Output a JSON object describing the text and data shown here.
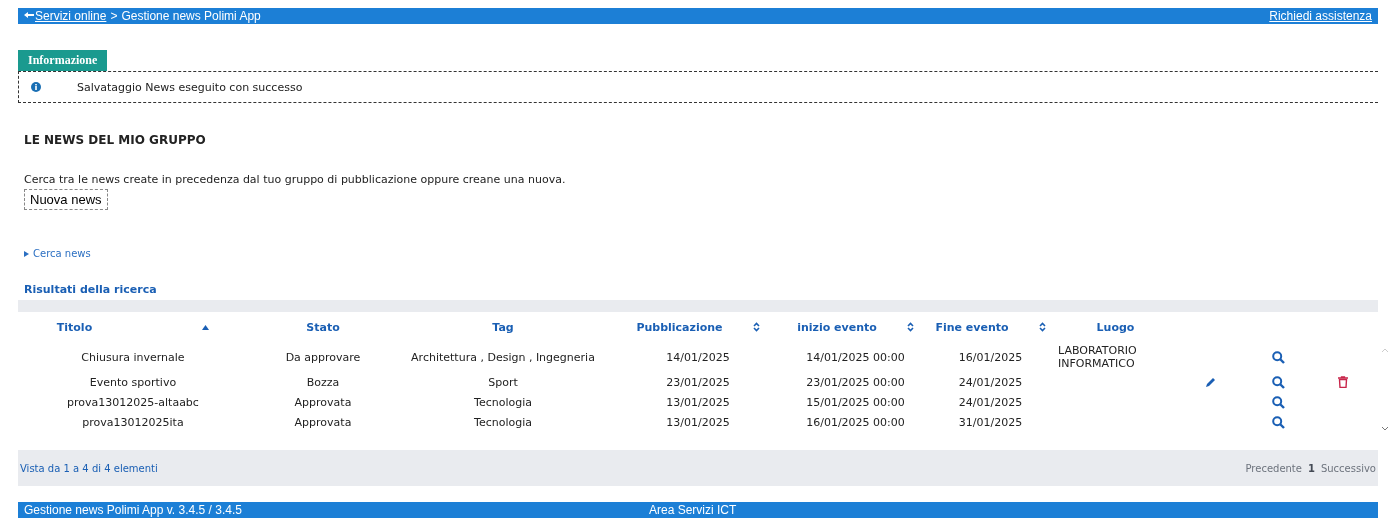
{
  "top_bar": {
    "back_link": "Servizi online",
    "separator": ">",
    "current": "Gestione news Polimi App",
    "help_link": "Richiedi assistenza"
  },
  "message": {
    "tab": "Informazione",
    "kind": "info",
    "text": "Salvataggio News eseguito con successo"
  },
  "section": {
    "title": "LE NEWS DEL MIO GRUPPO",
    "description": "Cerca tra le news create in precedenza dal tuo gruppo di pubblicazione oppure creane una nuova.",
    "new_button": "Nuova news"
  },
  "search_toggle": {
    "label": "Cerca news",
    "expanded": false
  },
  "results": {
    "title": "Risultati della ricerca",
    "columns": [
      {
        "label": "Titolo",
        "kind": "ascending"
      },
      {
        "label": "Stato",
        "kind": "plain"
      },
      {
        "label": "Tag",
        "kind": "plain"
      },
      {
        "label": "Pubblicazione",
        "kind": "sortable"
      },
      {
        "label": "inizio evento",
        "kind": "sortable"
      },
      {
        "label": "Fine evento",
        "kind": "sortable"
      },
      {
        "label": "Luogo",
        "kind": "plain"
      }
    ],
    "rows": [
      {
        "cells": [
          "Chiusura invernale",
          "Da approvare",
          "Architettura , Design , Ingegneria",
          "14/01/2025",
          "14/01/2025 00:00",
          "16/01/2025",
          "LABORATORIO INFORMATICO"
        ],
        "edit": false,
        "view": true,
        "delete": false
      },
      {
        "cells": [
          "Evento sportivo",
          "Bozza",
          "Sport",
          "23/01/2025",
          "23/01/2025 00:00",
          "24/01/2025"
        ],
        "edit": true,
        "view": true,
        "delete": true
      },
      {
        "cells": [
          "prova13012025-altaabc",
          "Approvata",
          "Tecnologia",
          "13/01/2025",
          "15/01/2025 00:00",
          "24/01/2025"
        ],
        "edit": false,
        "view": true,
        "delete": false
      },
      {
        "cells": [
          "prova13012025ita",
          "Approvata",
          "Tecnologia",
          "13/01/2025",
          "16/01/2025 00:00",
          "31/01/2025"
        ],
        "edit": false,
        "view": true,
        "delete": false
      }
    ],
    "summary": "Vista da 1 a 4 di 4 elementi",
    "pagination": [
      {
        "label": "Precedente",
        "selected": false
      },
      {
        "label": "1",
        "selected": true
      },
      {
        "label": "Successivo",
        "selected": false
      }
    ]
  },
  "footer": {
    "version": "Gestione news Polimi App v. 3.4.5 / 3.4.5",
    "center": "Area Servizi ICT"
  }
}
